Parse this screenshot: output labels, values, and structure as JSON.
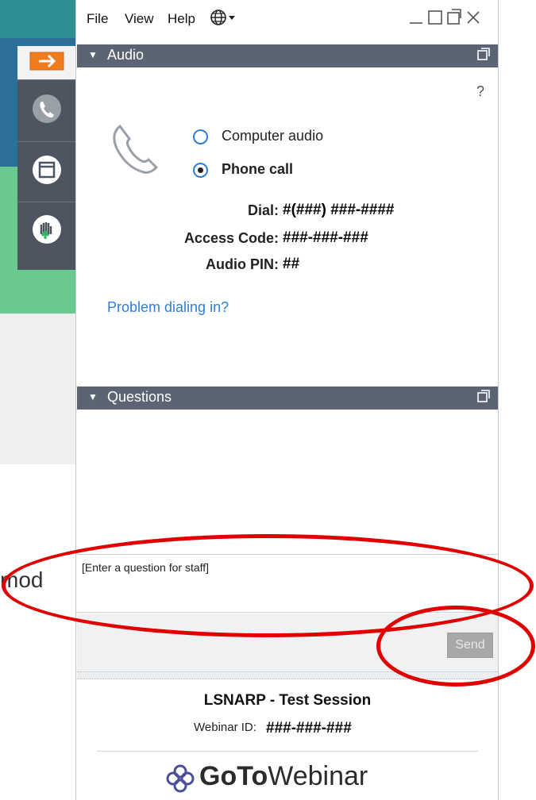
{
  "background": {
    "partial_text": "mod"
  },
  "menu": {
    "file": "File",
    "view": "View",
    "help": "Help",
    "language_icon": "globe-icon"
  },
  "audio_pane": {
    "title": "Audio",
    "help_mark": "?",
    "option_computer": "Computer audio",
    "option_phone": "Phone call",
    "selected": "Phone call",
    "dial_label": "Dial:",
    "dial_value": "#(###) ###-####",
    "access_label": "Access Code:",
    "access_value": "###-###-###",
    "pin_label": "Audio PIN:",
    "pin_value": "##",
    "problem_link": "Problem dialing in?"
  },
  "questions_pane": {
    "title": "Questions",
    "input_placeholder": "[Enter a question for staff]",
    "send_label": "Send"
  },
  "footer": {
    "session_title": "LSNARP - Test Session",
    "webinar_label": "Webinar ID:",
    "webinar_value": "###-###-###",
    "brand_goto": "GoTo",
    "brand_webinar": "Webinar"
  },
  "colors": {
    "header_bg": "#5b6473",
    "sidebar_bg": "#4d5561",
    "accent_orange": "#f07c1e",
    "link_blue": "#2f7ed3",
    "annotation_red": "#e00000"
  }
}
